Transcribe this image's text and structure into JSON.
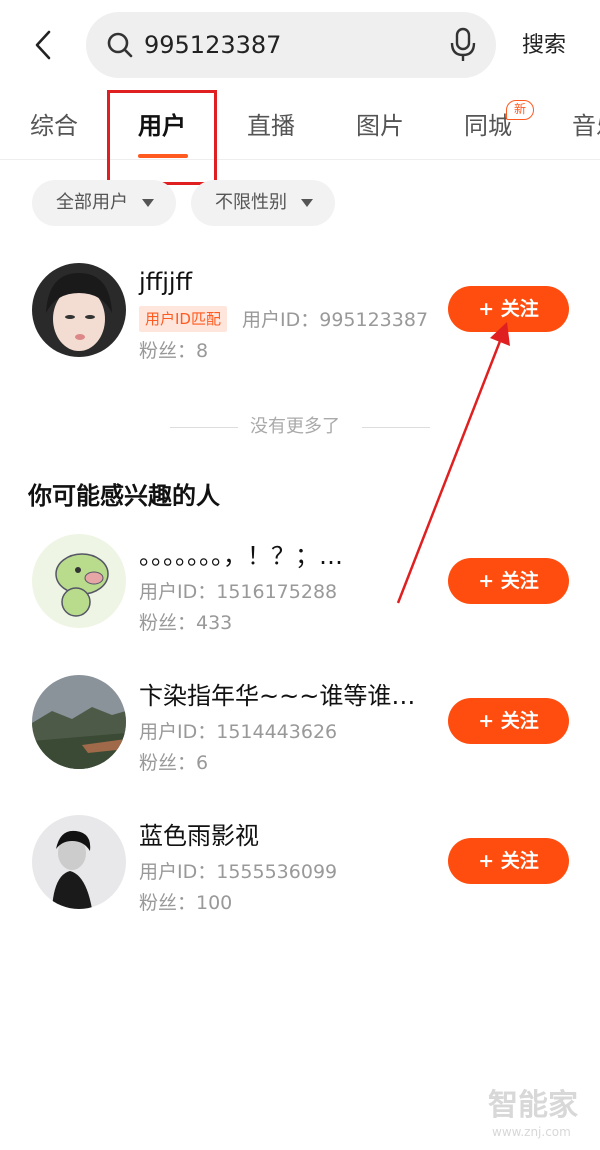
{
  "header": {
    "back_icon": "chevron-left-icon",
    "search_query": "995123387",
    "search_button": "搜索"
  },
  "tabs": [
    {
      "label": "综合"
    },
    {
      "label": "用户"
    },
    {
      "label": "直播"
    },
    {
      "label": "图片"
    },
    {
      "label": "同城",
      "badge": "新"
    },
    {
      "label": "音乐"
    }
  ],
  "filters": {
    "user_type": "全部用户",
    "gender": "不限性别"
  },
  "result": {
    "name": "jffjjff",
    "match_tag": "用户ID匹配",
    "id_line": "用户ID：995123387",
    "fans_line": "粉丝：8",
    "follow_label": "+ 关注"
  },
  "no_more": "没有更多了",
  "recommend": {
    "title": "你可能感兴趣的人",
    "users": [
      {
        "name": "。。。。。。。，！？；…",
        "id_line": "用户ID：1516175288",
        "fans_line": "粉丝：433",
        "follow_label": "+ 关注"
      },
      {
        "name": "卞染指年华~~~谁等谁…",
        "id_line": "用户ID：1514443626",
        "fans_line": "粉丝：6",
        "follow_label": "+ 关注"
      },
      {
        "name": "蓝色雨影视",
        "id_line": "用户ID：1555536099",
        "fans_line": "粉丝：100",
        "follow_label": "+ 关注"
      }
    ]
  },
  "watermark": {
    "brand": "智能家",
    "url": "www.znj.com"
  },
  "colors": {
    "accent": "#ff4d0f",
    "annotation": "#e02020"
  }
}
